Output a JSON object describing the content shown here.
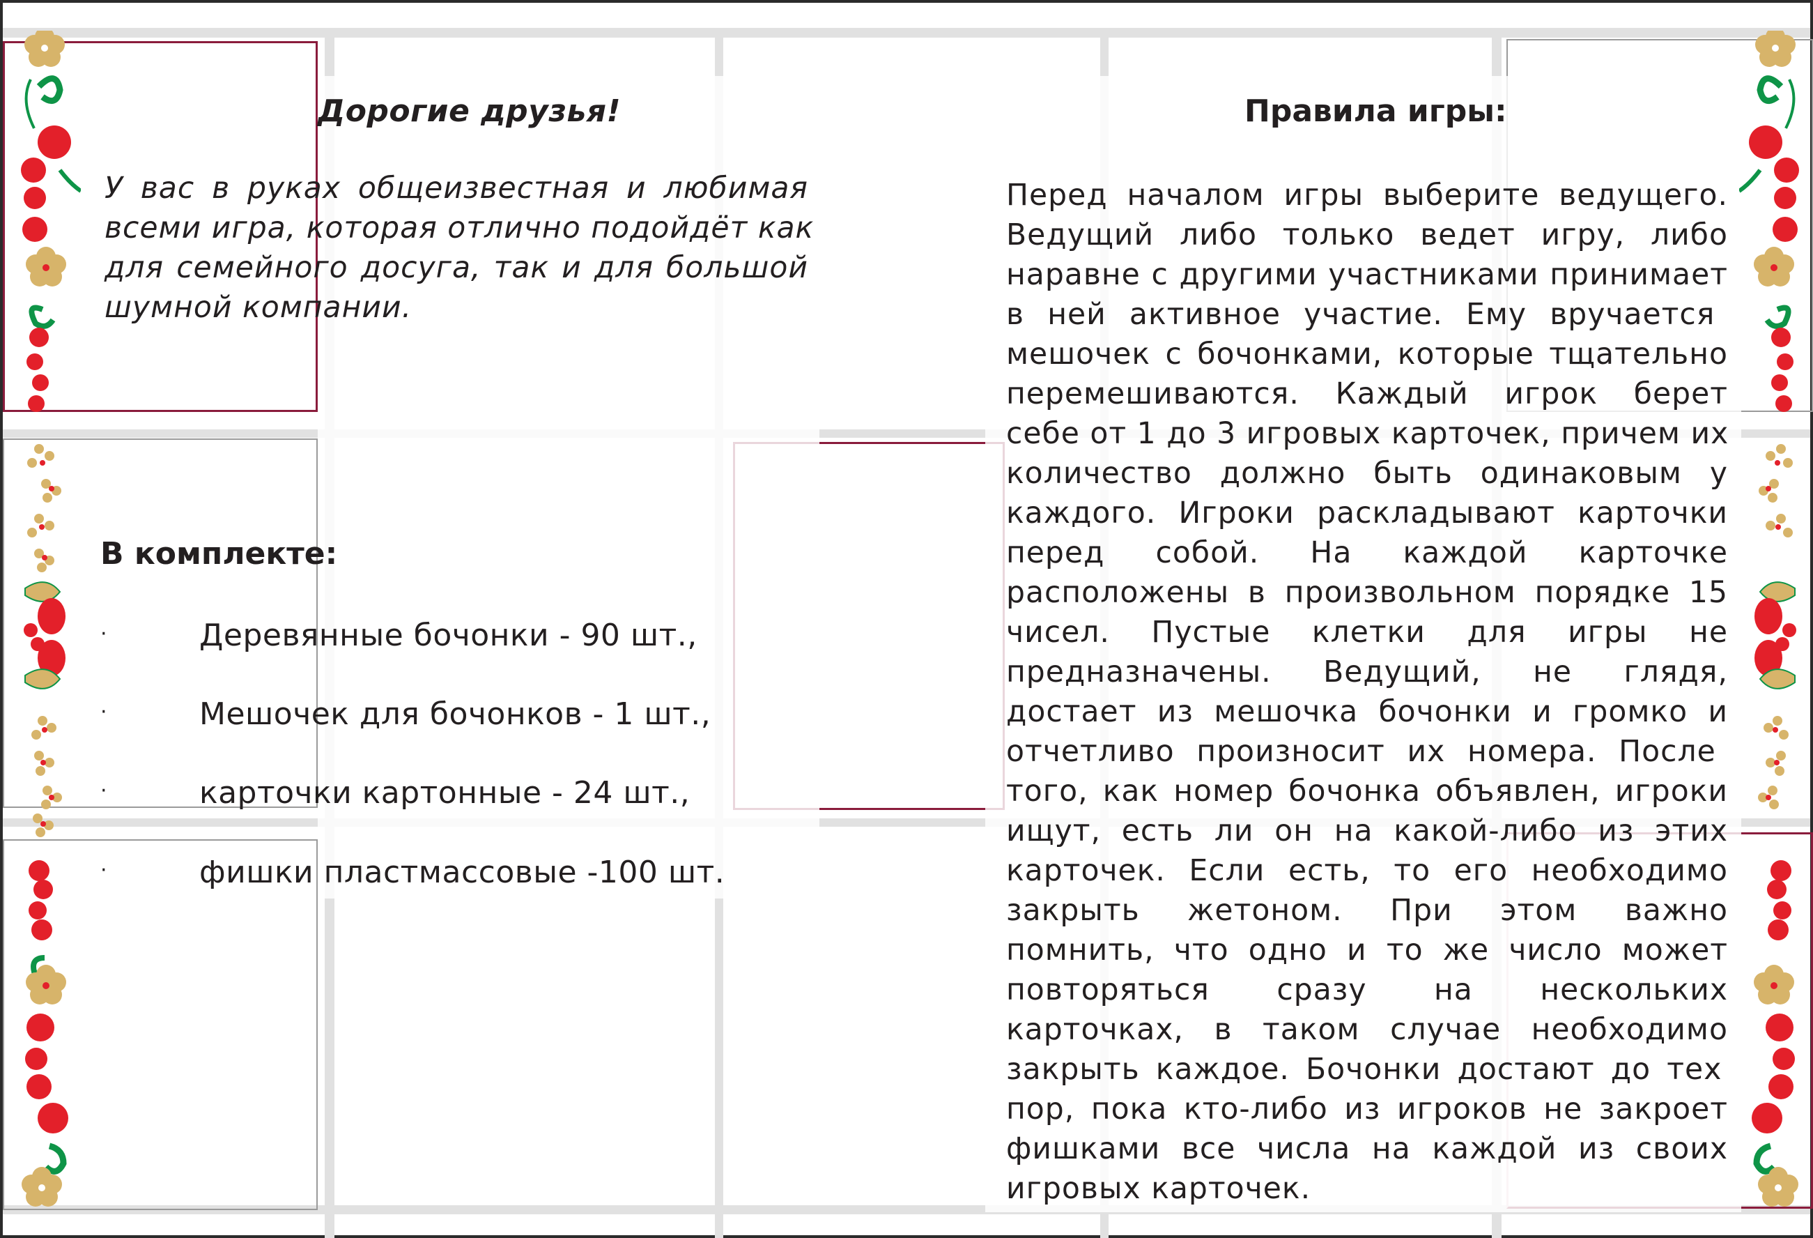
{
  "left_page": {
    "greeting_title": "Дорогие друзья!",
    "intro_lines": [
      "У вас в руках общеизвестная и любимая",
      "всеми игра, которая отлично подойдёт как",
      "для семейного досуга, так и для большой",
      "шумной компании."
    ],
    "kit_title": "В комплекте:",
    "kit_bullet": "·",
    "kit_items": [
      "Деревянные бочонки - 90 шт.,",
      "Мешочек для бочонков - 1 шт.,",
      "карточки картонные - 24 шт.,",
      "фишки пластмассовые -100 шт."
    ]
  },
  "right_page": {
    "rules_title": "Правила игры:",
    "rules_lines": [
      "Перед началом игры выберите ведущего.",
      "Ведущий либо только ведет игру, либо",
      "наравне с другими участниками принимает",
      "в ней  активное участие. Ему вручается",
      "мешочек с бочонками, которые тщательно",
      "перемешиваются. Каждый игрок берет",
      "себе от 1 до 3 игровых карточек, причем их",
      "количество должно быть одинаковым у",
      "каждого. Игроки раскладывают карточки",
      "перед собой. На каждой карточке",
      "расположены в произвольном порядке 15",
      "чисел. Пустые клетки для игры не",
      "предназначены. Ведущий, не глядя,",
      "достает из мешочка бочонки и громко и",
      "отчетливо  произносит их номера. После",
      "того, как номер бочонка объявлен, игроки",
      "ищут, есть ли он на какой-либо из этих",
      "карточек. Если есть, то его необходимо",
      "закрыть жетоном. При этом важно",
      "помнить, что одно и то же число может",
      "повторяться сразу на нескольких",
      "карточках, в таком случае необходимо",
      "закрыть каждое.  Бочонки достают до тех",
      "пор, пока кто-либо из игроков не закроет",
      "фишками все числа на каждой из своих",
      "игровых карточек."
    ]
  },
  "ornament": {
    "left_icon": "khokhloma-floral-border",
    "right_icon": "khokhloma-floral-border",
    "colors": {
      "red": "#e3202a",
      "green": "#0e9447",
      "gold": "#d7b46a",
      "maroon_frame": "#8a1c3c",
      "grid_grey": "#e1e1e1",
      "text": "#231f20"
    }
  }
}
